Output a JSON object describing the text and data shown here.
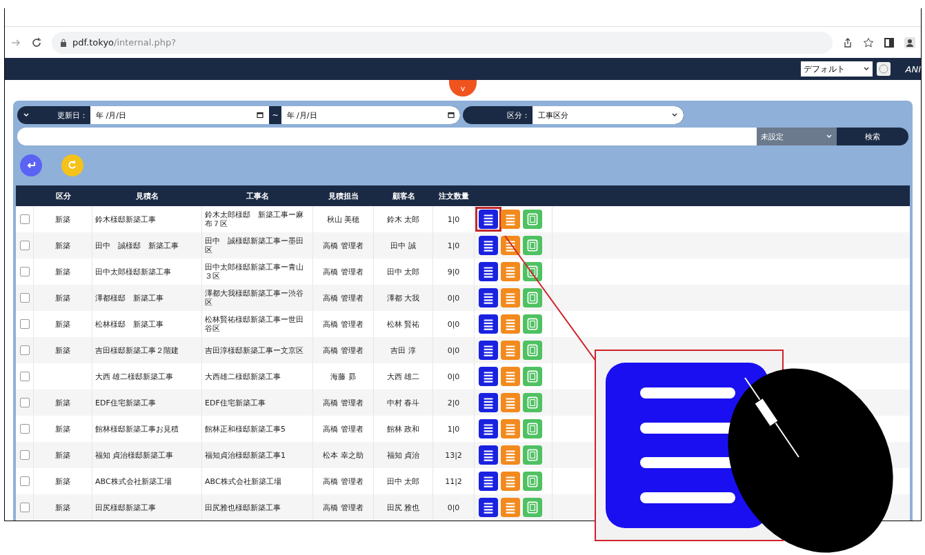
{
  "browser": {
    "domain": "pdf.tokyo",
    "path": "/internal.php?"
  },
  "nav": {
    "layout_select": "デフォルト",
    "logo_text": "ANI"
  },
  "toggle_badge": "v",
  "filters": {
    "date_label": "更新日：",
    "date_from": "年 /月/日",
    "range_sep": "~",
    "date_to": "年 /月/日",
    "category_label": "区分：",
    "category_value": "工事区分",
    "search_select": "未設定",
    "search_button": "検索"
  },
  "table": {
    "columns": [
      "区分",
      "見積名",
      "工事名",
      "見積担当",
      "顧客名",
      "注文数量"
    ],
    "rows": [
      {
        "checked": false,
        "highlighted": true,
        "kubun": "新築",
        "estimate": "鈴木様邸新築工事",
        "project": "鈴木太郎様邸　新築工事ー麻布７区",
        "staff": "秋山 美穂",
        "customer": "鈴木 太郎",
        "qty": "1|0"
      },
      {
        "checked": false,
        "highlighted": false,
        "kubun": "新築",
        "estimate": "田中　誠様邸　新築工事",
        "project": "田中　誠様邸新築工事ー墨田区",
        "staff": "高橋 管理者",
        "customer": "田中 誠",
        "qty": "1|0"
      },
      {
        "checked": false,
        "highlighted": false,
        "kubun": "新築",
        "estimate": "田中太郎様邸新築工事",
        "project": "田中太郎様邸新築工事ー青山３区",
        "staff": "高橋 管理者",
        "customer": "田中 太郎",
        "qty": "9|0"
      },
      {
        "checked": false,
        "highlighted": false,
        "kubun": "新築",
        "estimate": "澤都様邸　新築工事",
        "project": "澤都大我様邸新築工事ー渋谷区",
        "staff": "高橋 管理者",
        "customer": "澤都 大我",
        "qty": "0|0"
      },
      {
        "checked": false,
        "highlighted": false,
        "kubun": "新築",
        "estimate": "松林様邸　新築工事",
        "project": "松林賢祐様邸新築工事ー世田谷区",
        "staff": "高橋 管理者",
        "customer": "松林 賢祐",
        "qty": "0|0"
      },
      {
        "checked": false,
        "highlighted": false,
        "kubun": "新築",
        "estimate": "吉田様邸新築工事２階建",
        "project": "吉田淳様邸新築工事ー文京区",
        "staff": "高橋 管理者",
        "customer": "吉田 淳",
        "qty": "0|0"
      },
      {
        "checked": false,
        "highlighted": false,
        "estimate": "大西 雄二様邸新築工事",
        "project": "大西雄二様邸新築工事",
        "staff": "海藤 昴",
        "customer": "大西 雄二",
        "qty": "0|0"
      },
      {
        "checked": false,
        "highlighted": false,
        "kubun": "新築",
        "estimate": "EDF住宅新築工事",
        "project": "EDF住宅新築工事",
        "staff": "高橋 管理者",
        "customer": "中村 春斗",
        "qty": "2|0"
      },
      {
        "checked": false,
        "highlighted": false,
        "kubun": "新築",
        "estimate": "館林様邸新築工事お見積",
        "project": "館林正和様邸新築工事5",
        "staff": "高橋 管理者",
        "customer": "館林 政和",
        "qty": "1|0"
      },
      {
        "checked": false,
        "highlighted": false,
        "kubun": "新築",
        "estimate": "福知 貞治様邸新築工事",
        "project": "福知貞治様邸新築工事1",
        "staff": "松本 幸之助",
        "customer": "福知 貞治",
        "qty": "13|2"
      },
      {
        "checked": false,
        "highlighted": false,
        "kubun": "新築",
        "estimate": "ABC株式会社新築工場",
        "project": "ABC株式会社新築工場",
        "staff": "高橋 管理者",
        "customer": "田中 太郎",
        "qty": "11|2"
      },
      {
        "checked": false,
        "highlighted": false,
        "kubun": "新築",
        "estimate": "田尻様邸新築工事",
        "project": "田尻雅也様邸新築工事",
        "staff": "高橋 管理者",
        "customer": "田尻 雅也",
        "qty": "0|0"
      }
    ]
  }
}
